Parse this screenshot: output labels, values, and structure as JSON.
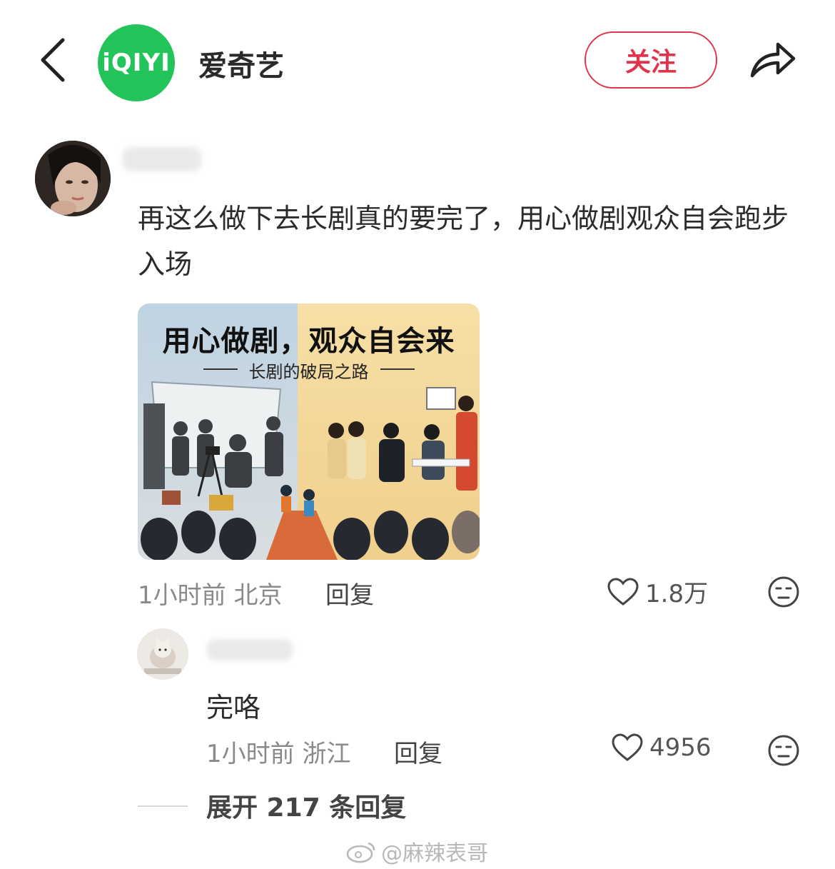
{
  "header": {
    "channel_name": "爱奇艺",
    "logo_text": "iQIYI",
    "follow_label": "关注"
  },
  "comment": {
    "text": "再这么做下去长剧真的要完了，用心做剧观众自会跑步入场",
    "image_title": "用心做剧，观众自会来",
    "image_subtitle": "长剧的破局之路",
    "time": "1小时前",
    "location": "北京",
    "reply_label": "回复",
    "likes": "1.8万"
  },
  "reply": {
    "text": "完咯",
    "time": "1小时前",
    "location": "浙江",
    "reply_label": "回复",
    "likes": "4956"
  },
  "expand_label": "展开 217 条回复",
  "watermark": "@麻辣表哥",
  "colors": {
    "accent": "#e0344d",
    "logo_green": "#22c45b"
  }
}
